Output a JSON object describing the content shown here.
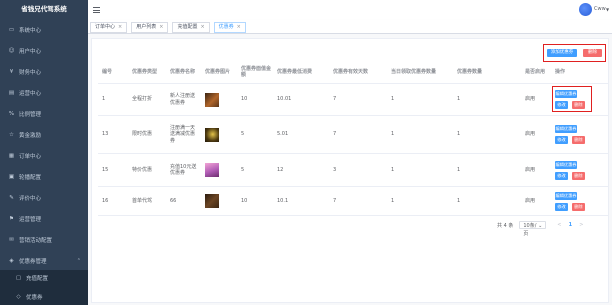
{
  "app": {
    "title": "省钱兄代驾系统"
  },
  "colors": {
    "sidebar_bg": "#304156",
    "primary": "#409eff",
    "danger": "#f56c6c",
    "annotation": "#e02020"
  },
  "sidebar": {
    "items": [
      {
        "label": "系统中心",
        "icon": "monitor-icon"
      },
      {
        "label": "用户中心",
        "icon": "user-icon"
      },
      {
        "label": "财务中心",
        "icon": "money-icon"
      },
      {
        "label": "运营中心",
        "icon": "chart-icon"
      },
      {
        "label": "比例管理",
        "icon": "percent-icon"
      },
      {
        "label": "黄金激励",
        "icon": "star-icon"
      },
      {
        "label": "订单中心",
        "icon": "order-icon"
      },
      {
        "label": "轮播配置",
        "icon": "image-icon"
      },
      {
        "label": "评价中心",
        "icon": "comment-icon"
      },
      {
        "label": "运营管理",
        "icon": "flag-icon"
      },
      {
        "label": "营销活动配置",
        "icon": "gift-icon"
      },
      {
        "label": "优惠券管理",
        "icon": "ticket-icon",
        "expanded": true
      }
    ],
    "submenu": [
      {
        "label": "充值配置",
        "icon": "wallet-icon"
      },
      {
        "label": "优惠券",
        "icon": "coupon-icon"
      }
    ]
  },
  "header": {
    "user_name": "Cww"
  },
  "tabs": [
    {
      "label": "订单中心",
      "active": false
    },
    {
      "label": "用户列表",
      "active": false
    },
    {
      "label": "充值配置",
      "active": false
    },
    {
      "label": "优惠券",
      "active": true
    }
  ],
  "toolbar": {
    "add_label": "添加优惠券",
    "delete_label": "删除"
  },
  "table": {
    "columns": [
      "编号",
      "优惠券类型",
      "优惠券名称",
      "优惠券图片",
      "优惠券面值金额",
      "优惠券最低消费",
      "优惠券有效天数",
      "当日领取优惠券数量",
      "优惠券数量",
      "是否启用",
      "操作"
    ],
    "rows": [
      {
        "id": "1",
        "type": "全程打折",
        "name": "新人注册送优惠券",
        "face_value": "10",
        "min_spend": "10.01",
        "valid_days": "7",
        "daily_limit": "1",
        "quantity": "1",
        "status": "启用"
      },
      {
        "id": "13",
        "type": "限时优惠",
        "name": "注册满一天送满减优惠券",
        "face_value": "5",
        "min_spend": "5.01",
        "valid_days": "7",
        "daily_limit": "1",
        "quantity": "1",
        "status": "启用"
      },
      {
        "id": "15",
        "type": "特价优惠",
        "name": "充值10元送优惠券",
        "face_value": "5",
        "min_spend": "12",
        "valid_days": "3",
        "daily_limit": "1",
        "quantity": "1",
        "status": "启用"
      },
      {
        "id": "16",
        "type": "首单代驾",
        "name": "66",
        "face_value": "10",
        "min_spend": "10.1",
        "valid_days": "7",
        "daily_limit": "1",
        "quantity": "1",
        "status": "启用"
      }
    ],
    "actions": {
      "edit_coupon": "编辑优惠券",
      "modify": "修改",
      "delete": "删除"
    }
  },
  "pagination": {
    "total": "共 4 条",
    "page_size": "10条/页",
    "current": "1",
    "prev": "<",
    "next": ">"
  }
}
